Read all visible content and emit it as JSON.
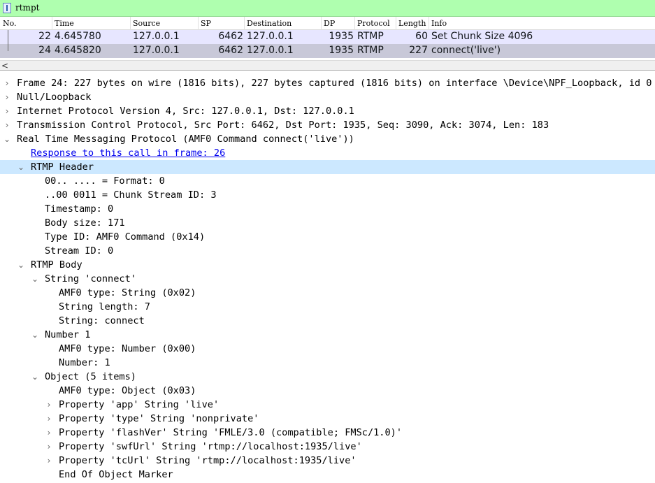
{
  "filter": {
    "value": "rtmpt"
  },
  "packet_list": {
    "columns": [
      "No.",
      "Time",
      "Source",
      "SP",
      "Destination",
      "DP",
      "Protocol",
      "Length",
      "Info"
    ],
    "rows": [
      [
        "22",
        "4.645780",
        "127.0.0.1",
        "6462",
        "127.0.0.1",
        "1935",
        "RTMP",
        "60",
        "Set Chunk Size 4096"
      ],
      [
        "24",
        "4.645820",
        "127.0.0.1",
        "6462",
        "127.0.0.1",
        "1935",
        "RTMP",
        "227",
        "connect('live')"
      ]
    ]
  },
  "scroll": {
    "left_arrow": "<"
  },
  "details": [
    {
      "text": "Frame 24: 227 bytes on wire (1816 bits), 227 bytes captured (1816 bits) on interface \\Device\\NPF_Loopback, id 0",
      "arrow": "›"
    },
    {
      "text": "Null/Loopback",
      "arrow": "›"
    },
    {
      "text": "Internet Protocol Version 4, Src: 127.0.0.1, Dst: 127.0.0.1",
      "arrow": "›"
    },
    {
      "text": "Transmission Control Protocol, Src Port: 6462, Dst Port: 1935, Seq: 3090, Ack: 3074, Len: 183",
      "arrow": "›"
    },
    {
      "text": "Real Time Messaging Protocol (AMF0 Command connect('live'))",
      "arrow": "⌄"
    },
    {
      "text": "Response to this call in frame: 26",
      "arrow": ""
    },
    {
      "text": "RTMP Header",
      "arrow": "⌄"
    },
    {
      "text": "00.. .... = Format: 0",
      "arrow": ""
    },
    {
      "text": "..00 0011 = Chunk Stream ID: 3",
      "arrow": ""
    },
    {
      "text": "Timestamp: 0",
      "arrow": ""
    },
    {
      "text": "Body size: 171",
      "arrow": ""
    },
    {
      "text": "Type ID: AMF0 Command (0x14)",
      "arrow": ""
    },
    {
      "text": "Stream ID: 0",
      "arrow": ""
    },
    {
      "text": "RTMP Body",
      "arrow": "⌄"
    },
    {
      "text": "String 'connect'",
      "arrow": "⌄"
    },
    {
      "text": "AMF0 type: String (0x02)",
      "arrow": ""
    },
    {
      "text": "String length: 7",
      "arrow": ""
    },
    {
      "text": "String: connect",
      "arrow": ""
    },
    {
      "text": "Number 1",
      "arrow": "⌄"
    },
    {
      "text": "AMF0 type: Number (0x00)",
      "arrow": ""
    },
    {
      "text": "Number: 1",
      "arrow": ""
    },
    {
      "text": "Object (5 items)",
      "arrow": "⌄"
    },
    {
      "text": "AMF0 type: Object (0x03)",
      "arrow": ""
    },
    {
      "text": "Property 'app' String 'live'",
      "arrow": "›"
    },
    {
      "text": "Property 'type' String 'nonprivate'",
      "arrow": "›"
    },
    {
      "text": "Property 'flashVer' String 'FMLE/3.0 (compatible; FMSc/1.0)'",
      "arrow": "›"
    },
    {
      "text": "Property 'swfUrl' String 'rtmp://localhost:1935/live'",
      "arrow": "›"
    },
    {
      "text": "Property 'tcUrl' String 'rtmp://localhost:1935/live'",
      "arrow": "›"
    },
    {
      "text": "End Of Object Marker",
      "arrow": ""
    }
  ]
}
